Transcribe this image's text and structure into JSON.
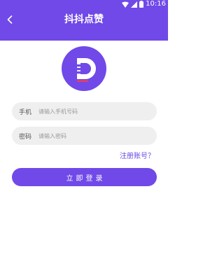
{
  "status_bar": {
    "time": "10:16",
    "icons": [
      "wifi-icon",
      "signal-icon",
      "battery-icon"
    ]
  },
  "header": {
    "title": "抖抖点赞",
    "back_icon": "chevron-left-icon"
  },
  "logo": {
    "letter": "D",
    "icon": "app-logo"
  },
  "form": {
    "phone_label": "手机",
    "phone_placeholder": "请输入手机号码",
    "phone_value": "",
    "password_label": "密码",
    "password_placeholder": "请输入密码",
    "password_value": ""
  },
  "register_link": "注册账号？",
  "login_button": "立即登录",
  "colors": {
    "primary": "#7049e8",
    "field_bg": "#efefef",
    "logo_accent": "#e83e62",
    "text_muted": "#999999"
  }
}
